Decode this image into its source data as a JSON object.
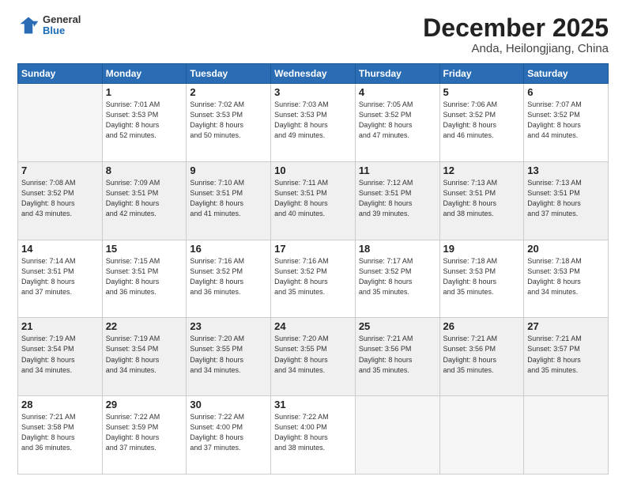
{
  "logo": {
    "line1": "General",
    "line2": "Blue"
  },
  "title": "December 2025",
  "subtitle": "Anda, Heilongjiang, China",
  "days_of_week": [
    "Sunday",
    "Monday",
    "Tuesday",
    "Wednesday",
    "Thursday",
    "Friday",
    "Saturday"
  ],
  "weeks": [
    [
      {
        "num": "",
        "info": ""
      },
      {
        "num": "1",
        "info": "Sunrise: 7:01 AM\nSunset: 3:53 PM\nDaylight: 8 hours\nand 52 minutes."
      },
      {
        "num": "2",
        "info": "Sunrise: 7:02 AM\nSunset: 3:53 PM\nDaylight: 8 hours\nand 50 minutes."
      },
      {
        "num": "3",
        "info": "Sunrise: 7:03 AM\nSunset: 3:53 PM\nDaylight: 8 hours\nand 49 minutes."
      },
      {
        "num": "4",
        "info": "Sunrise: 7:05 AM\nSunset: 3:52 PM\nDaylight: 8 hours\nand 47 minutes."
      },
      {
        "num": "5",
        "info": "Sunrise: 7:06 AM\nSunset: 3:52 PM\nDaylight: 8 hours\nand 46 minutes."
      },
      {
        "num": "6",
        "info": "Sunrise: 7:07 AM\nSunset: 3:52 PM\nDaylight: 8 hours\nand 44 minutes."
      }
    ],
    [
      {
        "num": "7",
        "info": "Sunrise: 7:08 AM\nSunset: 3:52 PM\nDaylight: 8 hours\nand 43 minutes."
      },
      {
        "num": "8",
        "info": "Sunrise: 7:09 AM\nSunset: 3:51 PM\nDaylight: 8 hours\nand 42 minutes."
      },
      {
        "num": "9",
        "info": "Sunrise: 7:10 AM\nSunset: 3:51 PM\nDaylight: 8 hours\nand 41 minutes."
      },
      {
        "num": "10",
        "info": "Sunrise: 7:11 AM\nSunset: 3:51 PM\nDaylight: 8 hours\nand 40 minutes."
      },
      {
        "num": "11",
        "info": "Sunrise: 7:12 AM\nSunset: 3:51 PM\nDaylight: 8 hours\nand 39 minutes."
      },
      {
        "num": "12",
        "info": "Sunrise: 7:13 AM\nSunset: 3:51 PM\nDaylight: 8 hours\nand 38 minutes."
      },
      {
        "num": "13",
        "info": "Sunrise: 7:13 AM\nSunset: 3:51 PM\nDaylight: 8 hours\nand 37 minutes."
      }
    ],
    [
      {
        "num": "14",
        "info": "Sunrise: 7:14 AM\nSunset: 3:51 PM\nDaylight: 8 hours\nand 37 minutes."
      },
      {
        "num": "15",
        "info": "Sunrise: 7:15 AM\nSunset: 3:51 PM\nDaylight: 8 hours\nand 36 minutes."
      },
      {
        "num": "16",
        "info": "Sunrise: 7:16 AM\nSunset: 3:52 PM\nDaylight: 8 hours\nand 36 minutes."
      },
      {
        "num": "17",
        "info": "Sunrise: 7:16 AM\nSunset: 3:52 PM\nDaylight: 8 hours\nand 35 minutes."
      },
      {
        "num": "18",
        "info": "Sunrise: 7:17 AM\nSunset: 3:52 PM\nDaylight: 8 hours\nand 35 minutes."
      },
      {
        "num": "19",
        "info": "Sunrise: 7:18 AM\nSunset: 3:53 PM\nDaylight: 8 hours\nand 35 minutes."
      },
      {
        "num": "20",
        "info": "Sunrise: 7:18 AM\nSunset: 3:53 PM\nDaylight: 8 hours\nand 34 minutes."
      }
    ],
    [
      {
        "num": "21",
        "info": "Sunrise: 7:19 AM\nSunset: 3:54 PM\nDaylight: 8 hours\nand 34 minutes."
      },
      {
        "num": "22",
        "info": "Sunrise: 7:19 AM\nSunset: 3:54 PM\nDaylight: 8 hours\nand 34 minutes."
      },
      {
        "num": "23",
        "info": "Sunrise: 7:20 AM\nSunset: 3:55 PM\nDaylight: 8 hours\nand 34 minutes."
      },
      {
        "num": "24",
        "info": "Sunrise: 7:20 AM\nSunset: 3:55 PM\nDaylight: 8 hours\nand 34 minutes."
      },
      {
        "num": "25",
        "info": "Sunrise: 7:21 AM\nSunset: 3:56 PM\nDaylight: 8 hours\nand 35 minutes."
      },
      {
        "num": "26",
        "info": "Sunrise: 7:21 AM\nSunset: 3:56 PM\nDaylight: 8 hours\nand 35 minutes."
      },
      {
        "num": "27",
        "info": "Sunrise: 7:21 AM\nSunset: 3:57 PM\nDaylight: 8 hours\nand 35 minutes."
      }
    ],
    [
      {
        "num": "28",
        "info": "Sunrise: 7:21 AM\nSunset: 3:58 PM\nDaylight: 8 hours\nand 36 minutes."
      },
      {
        "num": "29",
        "info": "Sunrise: 7:22 AM\nSunset: 3:59 PM\nDaylight: 8 hours\nand 37 minutes."
      },
      {
        "num": "30",
        "info": "Sunrise: 7:22 AM\nSunset: 4:00 PM\nDaylight: 8 hours\nand 37 minutes."
      },
      {
        "num": "31",
        "info": "Sunrise: 7:22 AM\nSunset: 4:00 PM\nDaylight: 8 hours\nand 38 minutes."
      },
      {
        "num": "",
        "info": ""
      },
      {
        "num": "",
        "info": ""
      },
      {
        "num": "",
        "info": ""
      }
    ]
  ]
}
